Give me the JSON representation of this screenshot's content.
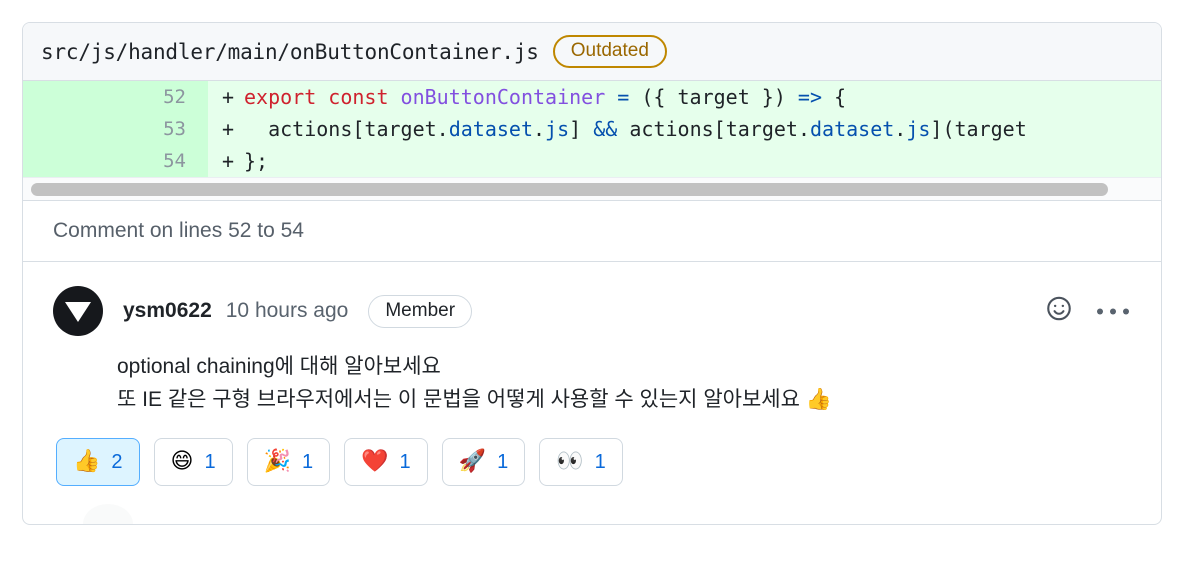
{
  "file_header": {
    "path": "src/js/handler/main/onButtonContainer.js",
    "outdated_label": "Outdated"
  },
  "diff": {
    "rows": [
      {
        "line_number": "52",
        "marker": "+",
        "segments": [
          {
            "text": "export const ",
            "kind": "keyword"
          },
          {
            "text": "onButtonContainer",
            "kind": "function"
          },
          {
            "text": " ",
            "kind": "plain"
          },
          {
            "text": "=",
            "kind": "operator"
          },
          {
            "text": " ({ target }) ",
            "kind": "plain"
          },
          {
            "text": "=>",
            "kind": "operator"
          },
          {
            "text": " {",
            "kind": "plain"
          }
        ]
      },
      {
        "line_number": "53",
        "marker": "+",
        "segments": [
          {
            "text": "  actions[target.",
            "kind": "plain"
          },
          {
            "text": "dataset",
            "kind": "property"
          },
          {
            "text": ".",
            "kind": "plain"
          },
          {
            "text": "js",
            "kind": "property"
          },
          {
            "text": "] ",
            "kind": "plain"
          },
          {
            "text": "&&",
            "kind": "operator"
          },
          {
            "text": " actions[target.",
            "kind": "plain"
          },
          {
            "text": "dataset",
            "kind": "property"
          },
          {
            "text": ".",
            "kind": "plain"
          },
          {
            "text": "js",
            "kind": "property"
          },
          {
            "text": "](target",
            "kind": "plain"
          }
        ]
      },
      {
        "line_number": "54",
        "marker": "+",
        "segments": [
          {
            "text": "};",
            "kind": "plain"
          }
        ]
      }
    ]
  },
  "lines_bar": {
    "label": "Comment on lines 52 to 54"
  },
  "comment": {
    "avatar_icon": "triangle-down-avatar",
    "author": "ysm0622",
    "timestamp": "10 hours ago",
    "role_badge": "Member",
    "reaction_icon": "smiley-icon",
    "menu_icon": "kebab-menu-icon",
    "body_lines": [
      "optional chaining에 대해 알아보세요",
      "또 IE 같은 구형 브라우저에서는 이 문법을 어떻게 사용할 수 있는지 알아보세요 👍"
    ]
  },
  "reactions": [
    {
      "name": "thumbs-up",
      "emoji": "👍",
      "count": "2",
      "reacted": true
    },
    {
      "name": "laugh",
      "emoji": "😄",
      "count": "1",
      "reacted": false
    },
    {
      "name": "hooray",
      "emoji": "🎉",
      "count": "1",
      "reacted": false
    },
    {
      "name": "heart",
      "emoji": "❤️",
      "count": "1",
      "reacted": false
    },
    {
      "name": "rocket",
      "emoji": "🚀",
      "count": "1",
      "reacted": false
    },
    {
      "name": "eyes",
      "emoji": "👀",
      "count": "1",
      "reacted": false
    }
  ],
  "colors": {
    "diff_add_bg": "#e6ffec",
    "diff_gutter_bg": "#ccffd8",
    "accent_blue": "#0969da",
    "outdated_amber": "#9a6700",
    "keyword_red": "#cf222e",
    "function_purple": "#8250df",
    "operator_blue": "#0550ae"
  }
}
